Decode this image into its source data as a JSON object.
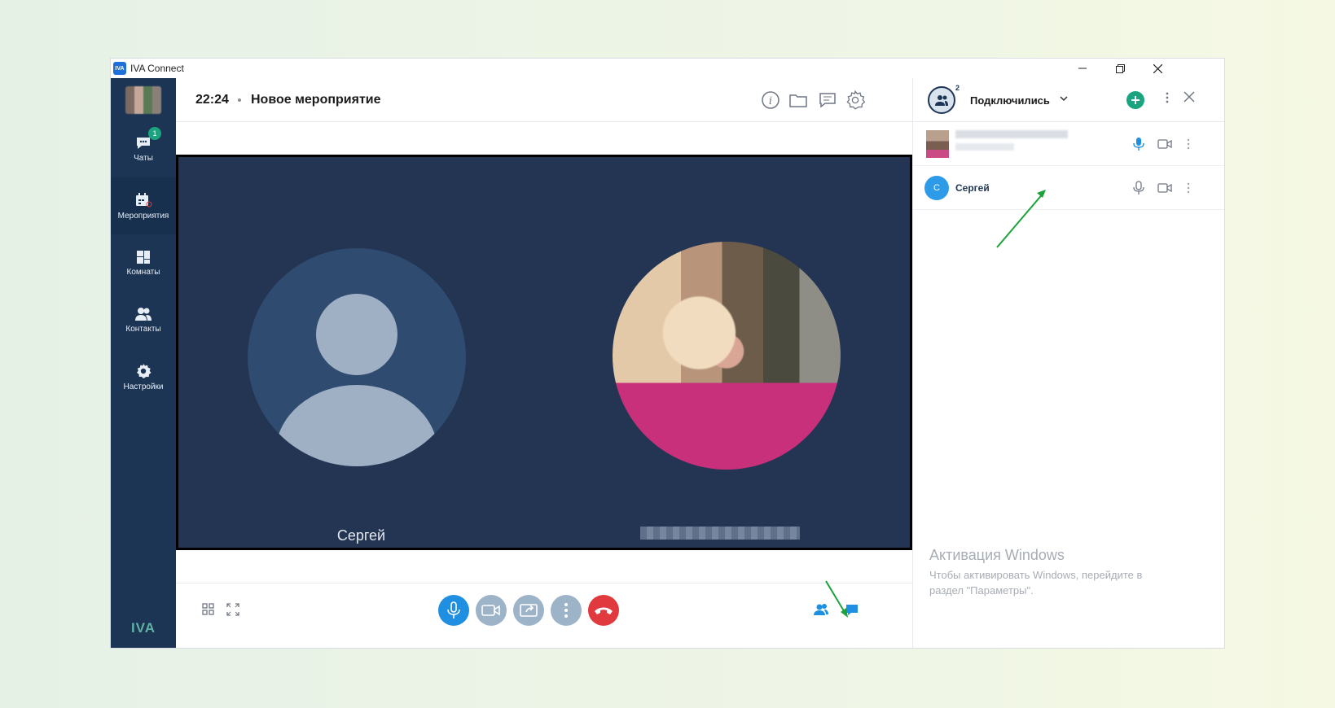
{
  "window": {
    "app_logo_text": "IVA",
    "title": "IVA Connect"
  },
  "sidebar": {
    "items": [
      {
        "label": "Чаты",
        "icon": "chat-icon",
        "badge": "1"
      },
      {
        "label": "Мероприятия",
        "icon": "calendar-icon",
        "active": true
      },
      {
        "label": "Комнаты",
        "icon": "rooms-icon"
      },
      {
        "label": "Контакты",
        "icon": "contacts-icon"
      },
      {
        "label": "Настройки",
        "icon": "gear-icon"
      }
    ],
    "logo": "IVA"
  },
  "header": {
    "time": "22:24",
    "title": "Новое мероприятие",
    "icons": [
      "info-icon",
      "folder-icon",
      "notes-icon",
      "settings-icon"
    ]
  },
  "video": {
    "tiles": [
      {
        "name": "Сергей",
        "type": "placeholder-avatar"
      },
      {
        "name": "",
        "type": "pixelated-photo"
      }
    ]
  },
  "controls": {
    "left_icons": [
      "grid-layout-icon",
      "fullscreen-icon"
    ],
    "center_buttons": [
      "microphone-icon",
      "camera-icon",
      "share-screen-icon",
      "more-icon",
      "hang-up-icon"
    ],
    "right_icons": [
      "participants-icon",
      "chat-bubble-icon"
    ],
    "colors": {
      "mic": "#1e8fe1",
      "end_call": "#e03a3e",
      "secondary": "#9db3c8"
    }
  },
  "panel": {
    "count": "2",
    "title": "Подключились",
    "participants": [
      {
        "name": "",
        "avatar_initial": "",
        "mic": "active"
      },
      {
        "name": "Сергей",
        "avatar_initial": "С",
        "mic": "muted"
      }
    ]
  },
  "watermark": {
    "title": "Активация Windows",
    "text": "Чтобы активировать Windows, перейдите в раздел \"Параметры\"."
  },
  "colors": {
    "sidebar_bg": "#1d3554",
    "tile_bg": "#233553",
    "accent_green": "#1aa580",
    "annotation_arrow": "#1aa33a"
  }
}
